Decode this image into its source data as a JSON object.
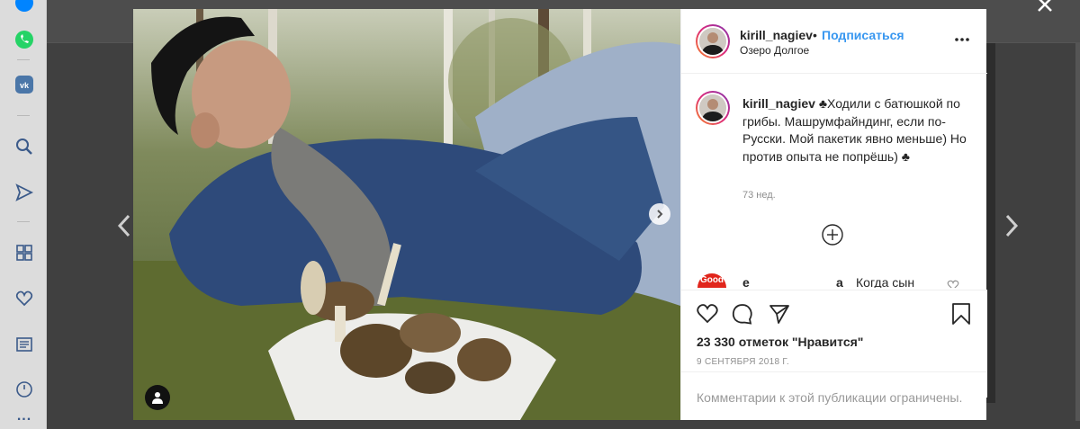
{
  "browser_sidebar": {
    "items": [
      {
        "icon": "messenger-icon"
      },
      {
        "icon": "whatsapp-icon"
      },
      {
        "icon": "vk-icon"
      },
      {
        "icon": "search-icon"
      },
      {
        "icon": "send-icon"
      },
      {
        "icon": "speed-dial-icon"
      },
      {
        "icon": "heart-icon"
      },
      {
        "icon": "news-icon"
      },
      {
        "icon": "history-icon"
      },
      {
        "icon": "more-icon"
      }
    ],
    "more_label": "..."
  },
  "colors": {
    "link_blue": "#3897f0",
    "text": "#262626",
    "muted": "#8e8e8e",
    "whatsapp": "#25d366",
    "vk": "#4a76a8",
    "messenger": "#0084ff"
  },
  "post": {
    "username": "kirill_nagiev",
    "separator": "•",
    "follow_label": "Подписаться",
    "location": "Озеро Долгое",
    "more_icon": "ellipsis-icon",
    "caption_user": "kirill_nagiev",
    "caption_text": "♣Ходили с батюшкой по грибы. Машрумфайндинг, если по-Русски. Мой пакетик явно меньше) Но против опыта не попрёшь) ♣",
    "caption_time": "73 нед.",
    "load_more_icon": "plus-circle-icon",
    "comment": {
      "avatar_text": "Good",
      "user_start": "e",
      "user_end": "a",
      "text": "Когда сын"
    },
    "likes": "23 330 отметок \"Нравится\"",
    "date": "9 СЕНТЯБРЯ 2018 Г.",
    "comments_restricted": "Комментарии к этой публикации ограничены."
  }
}
